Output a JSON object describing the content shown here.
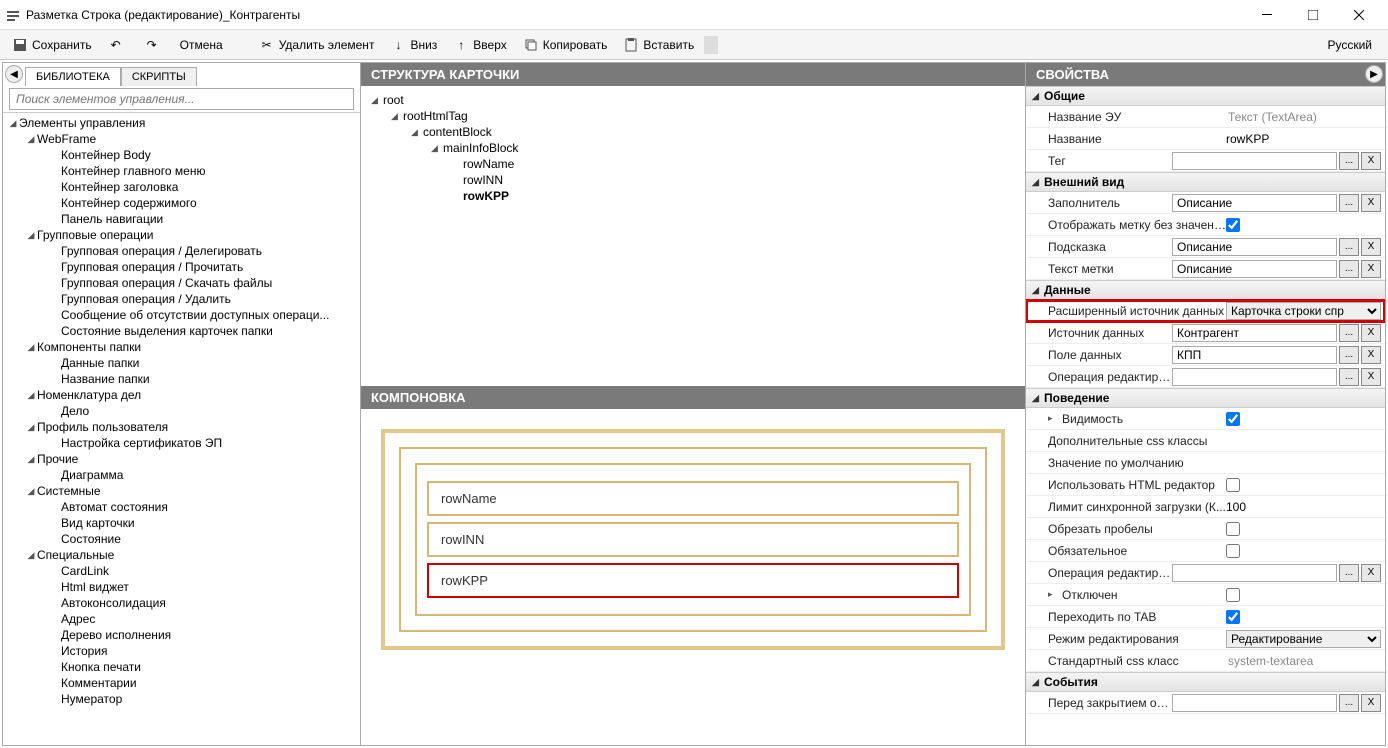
{
  "window": {
    "title": "Разметка Строка (редактирование)_Контрагенты"
  },
  "toolbar": {
    "save": "Сохранить",
    "cancel": "Отмена",
    "delete": "Удалить элемент",
    "down": "Вниз",
    "up": "Вверх",
    "copy": "Копировать",
    "paste": "Вставить",
    "lang": "Русский"
  },
  "left": {
    "tab_library": "БИБЛИОТЕКА",
    "tab_scripts": "СКРИПТЫ",
    "search_placeholder": "Поиск элементов управления...",
    "tree": {
      "root": "Элементы управления",
      "webframe": "WebFrame",
      "webframe_items": [
        "Контейнер Body",
        "Контейнер главного меню",
        "Контейнер заголовка",
        "Контейнер содержимого",
        "Панель навигации"
      ],
      "group_ops": "Групповые операции",
      "group_ops_items": [
        "Групповая операция / Делегировать",
        "Групповая операция / Прочитать",
        "Групповая операция / Скачать файлы",
        "Групповая операция / Удалить",
        "Сообщение об отсутствии доступных операци...",
        "Состояние выделения карточек папки"
      ],
      "folder_comp": "Компоненты папки",
      "folder_comp_items": [
        "Данные папки",
        "Название папки"
      ],
      "nomenclature": "Номенклатура дел",
      "nomenclature_items": [
        "Дело"
      ],
      "profile": "Профиль пользователя",
      "profile_items": [
        "Настройка сертификатов ЭП"
      ],
      "other": "Прочие",
      "other_items": [
        "Диаграмма"
      ],
      "system": "Системные",
      "system_items": [
        "Автомат состояния",
        "Вид карточки",
        "Состояние"
      ],
      "special": "Специальные",
      "special_items": [
        "CardLink",
        "Html виджет",
        "Автоконсолидация",
        "Адрес",
        "Дерево исполнения",
        "История",
        "Кнопка печати",
        "Комментарии",
        "Нумератор"
      ]
    }
  },
  "middle": {
    "structure_header": "СТРУКТУРА КАРТОЧКИ",
    "layout_header": "КОМПОНОВКА",
    "struct": {
      "root": "root",
      "rootHtmlTag": "rootHtmlTag",
      "contentBlock": "contentBlock",
      "mainInfoBlock": "mainInfoBlock",
      "rowName": "rowName",
      "rowINN": "rowINN",
      "rowKPP": "rowKPP"
    },
    "layout_rows": [
      "rowName",
      "rowINN",
      "rowKPP"
    ]
  },
  "right": {
    "header": "СВОЙСТВА",
    "groups": {
      "general": "Общие",
      "appearance": "Внешний вид",
      "data": "Данные",
      "behavior": "Поведение",
      "events": "События"
    },
    "general": {
      "name_eu_label": "Название ЭУ",
      "name_eu_val": "Текст (TextArea)",
      "name_label": "Название",
      "name_val": "rowKPP",
      "tag_label": "Тег"
    },
    "appearance": {
      "placeholder_label": "Заполнитель",
      "placeholder_val": "Описание",
      "show_label_no_val_label": "Отображать метку без значения",
      "show_label_no_val_checked": true,
      "hint_label": "Подсказка",
      "hint_val": "Описание",
      "label_text_label": "Текст метки",
      "label_text_val": "Описание"
    },
    "data": {
      "ext_src_label": "Расширенный источник данных",
      "ext_src_val": "Карточка строки спр",
      "src_label": "Источник данных",
      "src_val": "Контрагент",
      "field_label": "Поле данных",
      "field_val": "КПП",
      "edit_op_label": "Операция редактирования (на..."
    },
    "behavior": {
      "visibility_label": "Видимость",
      "visibility_checked": true,
      "css_classes_label": "Дополнительные css классы",
      "default_val_label": "Значение по умолчанию",
      "use_html_label": "Использовать HTML редактор",
      "use_html_checked": false,
      "sync_limit_label": "Лимит синхронной загрузки (К...",
      "sync_limit_val": "100",
      "trim_label": "Обрезать пробелы",
      "trim_checked": false,
      "required_label": "Обязательное",
      "required_checked": false,
      "edit_op2_label": "Операция редактирования дл...",
      "disabled_label": "Отключен",
      "disabled_checked": false,
      "tab_label": "Переходить по TAB",
      "tab_checked": true,
      "edit_mode_label": "Режим редактирования",
      "edit_mode_val": "Редактирование",
      "std_css_label": "Стандартный css класс",
      "std_css_val": "system-textarea"
    },
    "events": {
      "before_close_label": "Перед закрытием окна редакт..."
    },
    "btn_more": "...",
    "btn_x": "X"
  }
}
